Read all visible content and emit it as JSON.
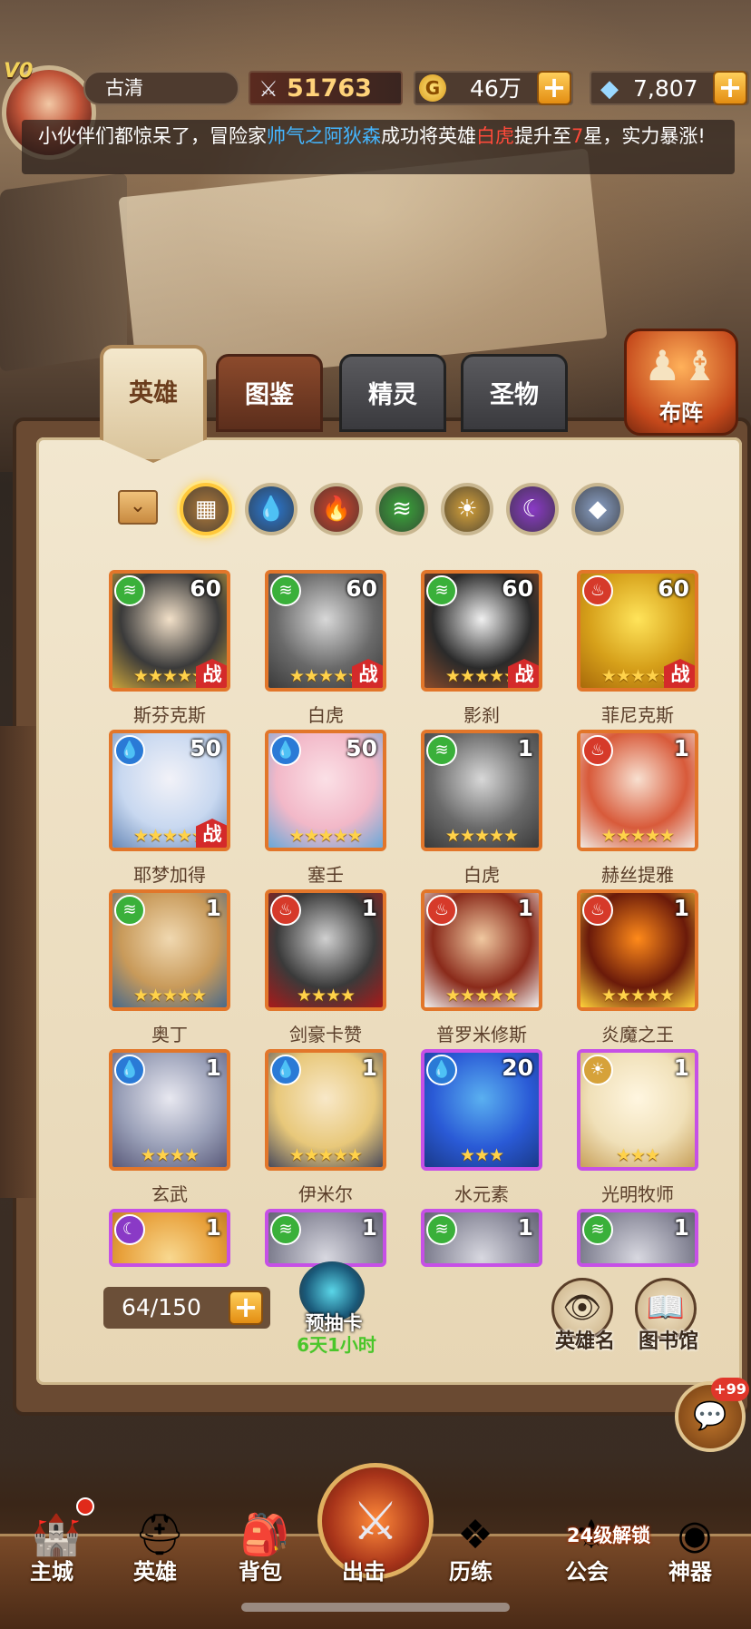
{
  "player": {
    "vip": "V0",
    "name": "古清"
  },
  "resources": {
    "power": "51763",
    "gold": "46万",
    "gold_icon": "G",
    "gems": "7,807"
  },
  "ticker": {
    "part1": "小伙伴们都惊呆了，冒险家",
    "player": "帅气之阿狄森",
    "part2": "成功将英雄",
    "hero": "白虎",
    "part3": "提升至",
    "stars": "7",
    "part4": "星，实力暴涨!"
  },
  "tabs": [
    "英雄",
    "图鉴",
    "精灵",
    "圣物"
  ],
  "formation_label": "布阵",
  "filters": [
    {
      "icon": "all-icon",
      "glyph": "▦",
      "color": "#b07a3a"
    },
    {
      "icon": "water-icon",
      "glyph": "💧",
      "color": "#2a7ad6"
    },
    {
      "icon": "fire-icon",
      "glyph": "🔥",
      "color": "#d6442a"
    },
    {
      "icon": "wind-icon",
      "glyph": "≋",
      "color": "#3aa83a"
    },
    {
      "icon": "light-icon",
      "glyph": "☀",
      "color": "#d6a23a"
    },
    {
      "icon": "dark-icon",
      "glyph": "☾",
      "color": "#8a3ac6"
    },
    {
      "icon": "void-icon",
      "glyph": "◆",
      "color": "#8aa0c6"
    }
  ],
  "heroes": [
    {
      "name": "斯芬克斯",
      "level": "60",
      "element": "wind",
      "stars": 5,
      "battle": true,
      "frame": "orange",
      "art": [
        "#3a3a3a",
        "#f2e0c8",
        "#c8a23a"
      ]
    },
    {
      "name": "白虎",
      "level": "60",
      "element": "wind",
      "stars": 5,
      "battle": true,
      "frame": "orange",
      "art": [
        "#6a6a6a",
        "#d8d8d8",
        "#3a3a3a"
      ]
    },
    {
      "name": "影刹",
      "level": "60",
      "element": "wind",
      "stars": 5,
      "battle": true,
      "frame": "orange",
      "art": [
        "#2a2a2a",
        "#f0f0f0",
        "#8a4a2a"
      ]
    },
    {
      "name": "菲尼克斯",
      "level": "60",
      "element": "fire",
      "stars": 5,
      "battle": true,
      "frame": "orange",
      "art": [
        "#d6a01a",
        "#ffe45a",
        "#a86a0a"
      ]
    },
    {
      "name": "耶梦加得",
      "level": "50",
      "element": "water",
      "stars": 5,
      "battle": true,
      "frame": "orange",
      "art": [
        "#c8d8f0",
        "#f2f2f8",
        "#6a8ab8"
      ]
    },
    {
      "name": "塞壬",
      "level": "50",
      "element": "water",
      "stars": 5,
      "battle": false,
      "frame": "orange",
      "art": [
        "#f2b8c8",
        "#fbe0e6",
        "#6aa8d8"
      ]
    },
    {
      "name": "白虎",
      "level": "1",
      "element": "wind",
      "stars": 5,
      "battle": false,
      "frame": "orange",
      "art": [
        "#6a6a6a",
        "#d8d8d8",
        "#3a3a3a"
      ]
    },
    {
      "name": "赫丝提雅",
      "level": "1",
      "element": "fire",
      "stars": 5,
      "battle": false,
      "frame": "orange",
      "art": [
        "#d85a3a",
        "#f8e0d0",
        "#f0e8e0"
      ]
    },
    {
      "name": "奥丁",
      "level": "1",
      "element": "wind",
      "stars": 5,
      "battle": false,
      "frame": "orange",
      "art": [
        "#c89a5a",
        "#f0d8b0",
        "#4a6a8a"
      ]
    },
    {
      "name": "剑豪卡赞",
      "level": "1",
      "element": "fire",
      "stars": 4,
      "battle": false,
      "frame": "orange",
      "art": [
        "#3a3a3a",
        "#d0d0d0",
        "#a81a1a"
      ]
    },
    {
      "name": "普罗米修斯",
      "level": "1",
      "element": "fire",
      "stars": 5,
      "battle": false,
      "frame": "orange",
      "art": [
        "#8a2a1a",
        "#f0c8a0",
        "#f0f0f0"
      ]
    },
    {
      "name": "炎魔之王",
      "level": "1",
      "element": "fire",
      "stars": 5,
      "battle": false,
      "frame": "orange",
      "art": [
        "#6a1a0a",
        "#ff8a1a",
        "#ffd23a"
      ]
    },
    {
      "name": "玄武",
      "level": "1",
      "element": "water",
      "stars": 4,
      "battle": false,
      "frame": "orange",
      "art": [
        "#9aa0b8",
        "#e8e8f0",
        "#5a5a7a"
      ]
    },
    {
      "name": "伊米尔",
      "level": "1",
      "element": "water",
      "stars": 5,
      "battle": false,
      "frame": "orange",
      "art": [
        "#e8c87a",
        "#f8e8c8",
        "#4a4a5a"
      ]
    },
    {
      "name": "水元素",
      "level": "20",
      "element": "water",
      "stars": 3,
      "battle": false,
      "frame": "purple",
      "art": [
        "#2a5ad6",
        "#5ab0f0",
        "#1a3a8a"
      ]
    },
    {
      "name": "光明牧师",
      "level": "1",
      "element": "light",
      "stars": 3,
      "battle": false,
      "frame": "purple",
      "art": [
        "#f0e0b8",
        "#fff6e0",
        "#c8a05a"
      ]
    },
    {
      "name": "",
      "level": "1",
      "element": "dark",
      "stars": 0,
      "battle": false,
      "frame": "purple",
      "art": [
        "#e8a03a",
        "#f8d890",
        "#a86a1a"
      ]
    },
    {
      "name": "",
      "level": "1",
      "element": "wind",
      "stars": 0,
      "battle": false,
      "frame": "purple",
      "art": [
        "#8a8a9a",
        "#d8d8e0",
        "#4a4a5a"
      ]
    },
    {
      "name": "",
      "level": "1",
      "element": "wind",
      "stars": 0,
      "battle": false,
      "frame": "purple",
      "art": [
        "#8a8a9a",
        "#d8d8e0",
        "#4a4a5a"
      ]
    },
    {
      "name": "",
      "level": "1",
      "element": "wind",
      "stars": 0,
      "battle": false,
      "frame": "purple",
      "art": [
        "#8a8a9a",
        "#d8d8e0",
        "#4a4a5a"
      ]
    }
  ],
  "battle_badge": "战",
  "element_styles": {
    "wind": {
      "color": "#3ab03a",
      "glyph": "≋"
    },
    "fire": {
      "color": "#d63a2a",
      "glyph": "♨"
    },
    "water": {
      "color": "#2a7ad6",
      "glyph": "💧"
    },
    "light": {
      "color": "#d6a23a",
      "glyph": "☀"
    },
    "dark": {
      "color": "#8a3ac6",
      "glyph": "☾"
    }
  },
  "capacity": "64/150",
  "precard": {
    "label": "预抽卡",
    "timer": "6天1小时"
  },
  "side_buttons": {
    "hero_name": "英雄名",
    "library": "图书馆"
  },
  "chat_badge": "+99",
  "nav": [
    {
      "label": "主城",
      "icon": "castle-icon",
      "glyph": "🏰"
    },
    {
      "label": "英雄",
      "icon": "helmet-icon",
      "glyph": "⛑"
    },
    {
      "label": "背包",
      "icon": "backpack-icon",
      "glyph": "🎒"
    },
    {
      "label": "出击",
      "icon": "swords-icon",
      "glyph": "⚔"
    },
    {
      "label": "历练",
      "icon": "emblem-icon",
      "glyph": "❖"
    },
    {
      "label": "公会",
      "icon": "guild-icon",
      "glyph": "⚜"
    },
    {
      "label": "神器",
      "icon": "artifact-icon",
      "glyph": "◉"
    }
  ],
  "guild_lock": "24级解锁"
}
